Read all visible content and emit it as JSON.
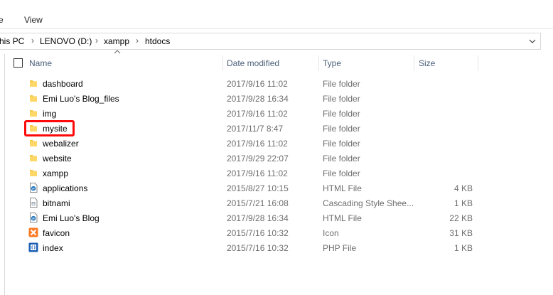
{
  "ribbon": {
    "tabs": [
      "e",
      "View"
    ]
  },
  "address": {
    "crumbs": [
      "his PC",
      "LENOVO (D:)",
      "xampp",
      "htdocs"
    ]
  },
  "columns": {
    "name": "Name",
    "date": "Date modified",
    "type": "Type",
    "size": "Size"
  },
  "files": [
    {
      "name": "dashboard",
      "date": "2017/9/16 11:02",
      "type": "File folder",
      "size": "",
      "icon": "folder-icon"
    },
    {
      "name": "Emi Luo's Blog_files",
      "date": "2017/9/28 16:34",
      "type": "File folder",
      "size": "",
      "icon": "folder-icon"
    },
    {
      "name": "img",
      "date": "2017/9/16 11:02",
      "type": "File folder",
      "size": "",
      "icon": "folder-icon"
    },
    {
      "name": "mysite",
      "date": "2017/11/7 8:47",
      "type": "File folder",
      "size": "",
      "icon": "folder-icon"
    },
    {
      "name": "webalizer",
      "date": "2017/9/16 11:02",
      "type": "File folder",
      "size": "",
      "icon": "folder-icon"
    },
    {
      "name": "website",
      "date": "2017/9/29 22:07",
      "type": "File folder",
      "size": "",
      "icon": "folder-icon"
    },
    {
      "name": "xampp",
      "date": "2017/9/16 11:02",
      "type": "File folder",
      "size": "",
      "icon": "folder-icon"
    },
    {
      "name": "applications",
      "date": "2015/8/27 10:15",
      "type": "HTML File",
      "size": "4 KB",
      "icon": "html-file-icon"
    },
    {
      "name": "bitnami",
      "date": "2015/7/21 16:08",
      "type": "Cascading Style Shee...",
      "size": "1 KB",
      "icon": "css-file-icon"
    },
    {
      "name": "Emi Luo's Blog",
      "date": "2017/9/28 16:34",
      "type": "HTML File",
      "size": "22 KB",
      "icon": "html-file-icon"
    },
    {
      "name": "favicon",
      "date": "2015/7/16 10:32",
      "type": "Icon",
      "size": "31 KB",
      "icon": "xampp-icon"
    },
    {
      "name": "index",
      "date": "2015/7/16 10:32",
      "type": "PHP File",
      "size": "1 KB",
      "icon": "php-file-icon"
    }
  ],
  "colors": {
    "highlight": "#ff0a0a",
    "folder": "#f3c84a",
    "header_text": "#4c607a"
  }
}
